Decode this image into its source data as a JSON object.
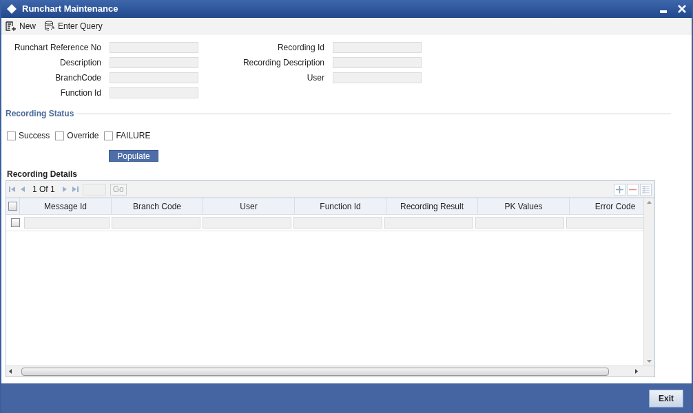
{
  "window": {
    "title": "Runchart Maintenance"
  },
  "toolbar": [
    {
      "kind": "new",
      "label": "New"
    },
    {
      "kind": "query",
      "label": "Enter Query"
    }
  ],
  "fields_left": [
    {
      "label": "Runchart Reference No"
    },
    {
      "label": "Description"
    },
    {
      "label": "BranchCode"
    },
    {
      "label": "Function Id"
    }
  ],
  "fields_right": [
    {
      "label": "Recording Id"
    },
    {
      "label": "Recording Description"
    },
    {
      "label": "User"
    }
  ],
  "recording_status": {
    "title": "Recording Status",
    "options": [
      {
        "label": "Success",
        "checked": false
      },
      {
        "label": "Override",
        "checked": false
      },
      {
        "label": "FAILURE",
        "checked": false
      }
    ]
  },
  "populate_button": "Populate",
  "recording_details": {
    "title": "Recording Details",
    "pager": "1 Of 1",
    "go": "Go",
    "select_all": {
      "checked": false
    },
    "columns": [
      "Message Id",
      "Branch Code",
      "User",
      "Function Id",
      "Recording Result",
      "PK Values",
      "Error Code"
    ],
    "rows": [
      {
        "checked": false
      }
    ]
  },
  "footer": {
    "exit": "Exit"
  }
}
